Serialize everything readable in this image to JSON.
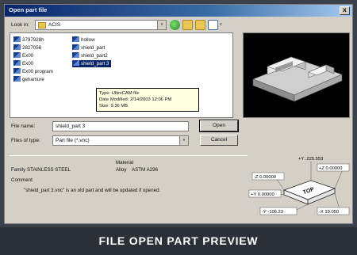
{
  "dialog": {
    "title": "Open part file",
    "close_glyph": "x"
  },
  "look_in": {
    "label": "Look in:",
    "value": "ACIS",
    "arrow": "v"
  },
  "toolbar": {
    "back_icon": "back-icon",
    "up_icon": "up-folder-icon",
    "new_icon": "new-folder-icon",
    "view_icon": "view-menu-icon",
    "view_arrow": "v"
  },
  "files": [
    {
      "name": "3797928h"
    },
    {
      "name": "2827056"
    },
    {
      "name": "Ex00"
    },
    {
      "name": "Ex00"
    },
    {
      "name": "Ex00 program"
    },
    {
      "name": "gehamure"
    },
    {
      "name": "hollow"
    },
    {
      "name": "shield_part"
    },
    {
      "name": "shield_part2"
    },
    {
      "name": "shield_part 3"
    }
  ],
  "tooltip": {
    "type": "Type: UltiniCAM file",
    "modified": "Date Modified: 2/14/2003 12:06 PM",
    "size": "Size: 9.36 MB"
  },
  "form": {
    "file_name_label": "File name:",
    "file_name_value": "shield_part 3",
    "files_type_label": "Files of type:",
    "files_type_value": "Part file (*.vnc)",
    "type_arrow": "v",
    "open": "Open",
    "cancel": "Cancel"
  },
  "info": {
    "material_label": "Material",
    "family_label": "Family",
    "family_value": "STAINLESS STEEL",
    "alloy_label": "Alloy",
    "alloy_value": "ASTM A296",
    "comment_label": "Comment",
    "comment_text": "\"shield_part 3.vnc\" is an old part and will be updated if opened."
  },
  "dims": {
    "top_value": "+Y .225.553",
    "plus_z": "+Z 0.00000",
    "neg_z": "-Z 0.00000",
    "plus_y": "+Y 0.00000",
    "neg_y": "-Y -106.23",
    "neg_x": "-X 19.050",
    "box_label": "TOP"
  },
  "caption": "FILE OPEN PART PREVIEW",
  "colors": {
    "titlebar": "#0a246a",
    "selection": "#0a246a",
    "tooltip": "#ffffe1",
    "caption_bg": "#2b2f37"
  }
}
